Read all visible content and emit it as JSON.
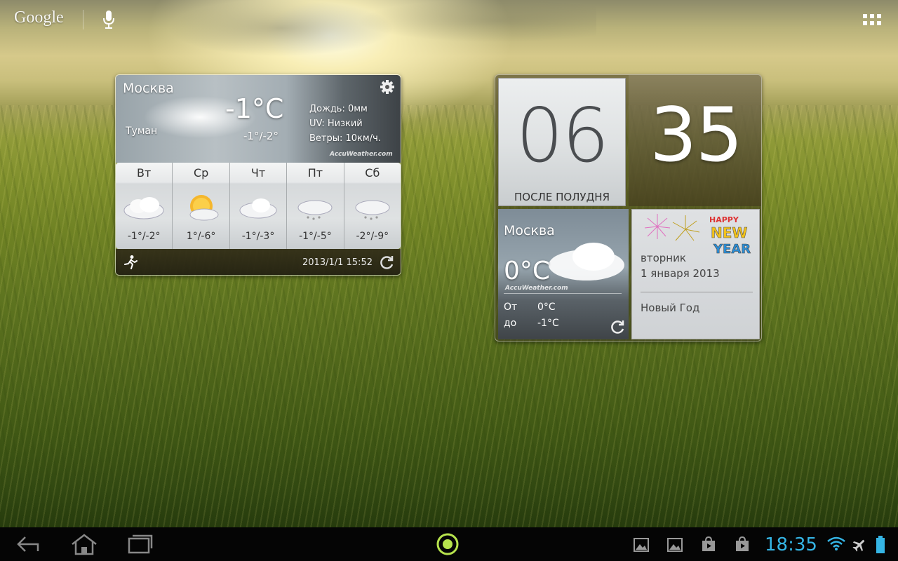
{
  "top_bar": {
    "search_logo": "Google"
  },
  "weather_widget": {
    "city": "Москва",
    "temperature": "-1°C",
    "condition": "Туман",
    "range": "-1°/-2°",
    "details": {
      "rain": "Дождь: 0мм",
      "uv": "UV: Низкий",
      "wind": "Ветры: 10км/ч."
    },
    "brand": "AccuWeather.com",
    "forecast": [
      {
        "day": "Вт",
        "range": "-1°/-2°",
        "icon": "cloudy-icon"
      },
      {
        "day": "Ср",
        "range": "1°/-6°",
        "icon": "partly-sunny-icon"
      },
      {
        "day": "Чт",
        "range": "-1°/-3°",
        "icon": "cloudy-icon"
      },
      {
        "day": "Пт",
        "range": "-1°/-5°",
        "icon": "snow-icon"
      },
      {
        "day": "Сб",
        "range": "-2°/-9°",
        "icon": "snow-icon"
      }
    ],
    "updated": "2013/1/1 15:52"
  },
  "clock_widget": {
    "hour": "06",
    "ampm": "ПОСЛЕ ПОЛУДНЯ",
    "minute": "35",
    "mini_weather": {
      "city": "Москва",
      "temperature": "0°C",
      "brand": "AccuWeather.com",
      "from_label": "От",
      "from_value": "0°C",
      "to_label": "до",
      "to_value": "-1°C"
    },
    "calendar": {
      "weekday": "вторник",
      "date": "1 января 2013",
      "event": "Новый Год",
      "art_text": [
        "HAPPY",
        "NEW",
        "YEAR"
      ]
    }
  },
  "status_bar": {
    "time": "18:35"
  },
  "colors": {
    "accent_clock": "#35b5e5",
    "nav_background": "#050505"
  }
}
